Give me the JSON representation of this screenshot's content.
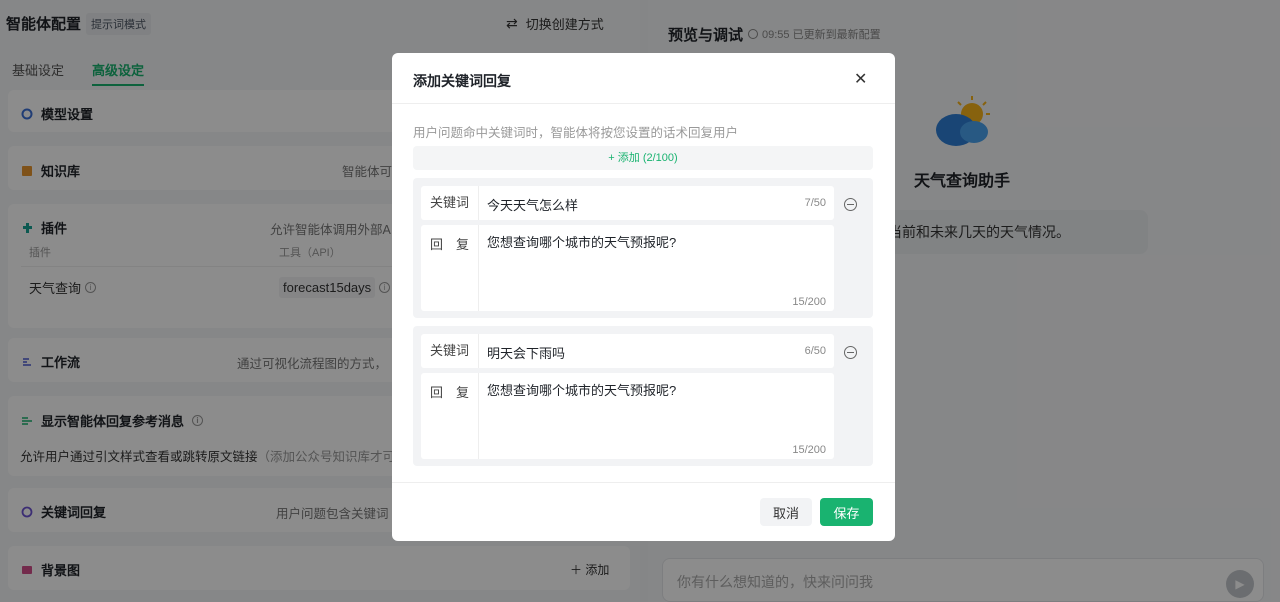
{
  "left": {
    "title": "智能体配置",
    "mode_badge": "提示词模式",
    "switch_label": "切换创建方式",
    "tabs": [
      {
        "label": "基础设定"
      },
      {
        "label": "高级设定"
      }
    ],
    "sections": {
      "model": {
        "title": "模型设置"
      },
      "knowledge": {
        "title": "知识库",
        "desc": "智能体可"
      },
      "plugins": {
        "title": "插件",
        "desc": "允许智能体调用外部A",
        "col_plugin": "插件",
        "col_tool": "工具（API）",
        "row_plugin": "天气查询",
        "row_tool": "forecast15days"
      },
      "workflow": {
        "title": "工作流",
        "desc": "通过可视化流程图的方式，"
      },
      "reference": {
        "title": "显示智能体回复参考消息",
        "desc": "允许用户通过引文样式查看或跳转原文链接",
        "desc_extra": "（添加公众号知识库才可"
      },
      "keyword": {
        "title": "关键词回复",
        "desc": "用户问题包含关键词"
      },
      "background": {
        "title": "背景图",
        "add_label": "添加"
      }
    }
  },
  "right": {
    "title": "预览与调试",
    "status": "09:55 已更新到最新配置",
    "agent_name": "天气查询助手",
    "agent_intro": "帮您查询当前和未来几天的天气情况。",
    "input_placeholder": "你有什么想知道的，快来问问我"
  },
  "modal": {
    "title": "添加关键词回复",
    "hint": "用户问题命中关键词时，智能体将按您设置的话术回复用户",
    "add_label": "+ 添加 (2/100)",
    "keyword_label": "关键词",
    "reply_label": "回　复",
    "items": [
      {
        "keyword": "今天天气怎么样",
        "keyword_count": "7/50",
        "reply": "您想查询哪个城市的天气预报呢?",
        "reply_count": "15/200"
      },
      {
        "keyword": "明天会下雨吗",
        "keyword_count": "6/50",
        "reply": "您想查询哪个城市的天气预报呢?",
        "reply_count": "15/200"
      }
    ],
    "cancel_label": "取消",
    "save_label": "保存"
  },
  "colors": {
    "accent": "#19b370",
    "overlay": "rgba(0,0,0,0.45)"
  },
  "icons": [
    "swap-icon",
    "model-icon",
    "knowledge-icon",
    "plugin-icon",
    "info-icon",
    "workflow-icon",
    "reference-icon",
    "keyword-icon",
    "image-icon",
    "plus-icon",
    "clock-icon",
    "weather-logo-icon",
    "send-icon",
    "close-icon",
    "remove-icon"
  ]
}
